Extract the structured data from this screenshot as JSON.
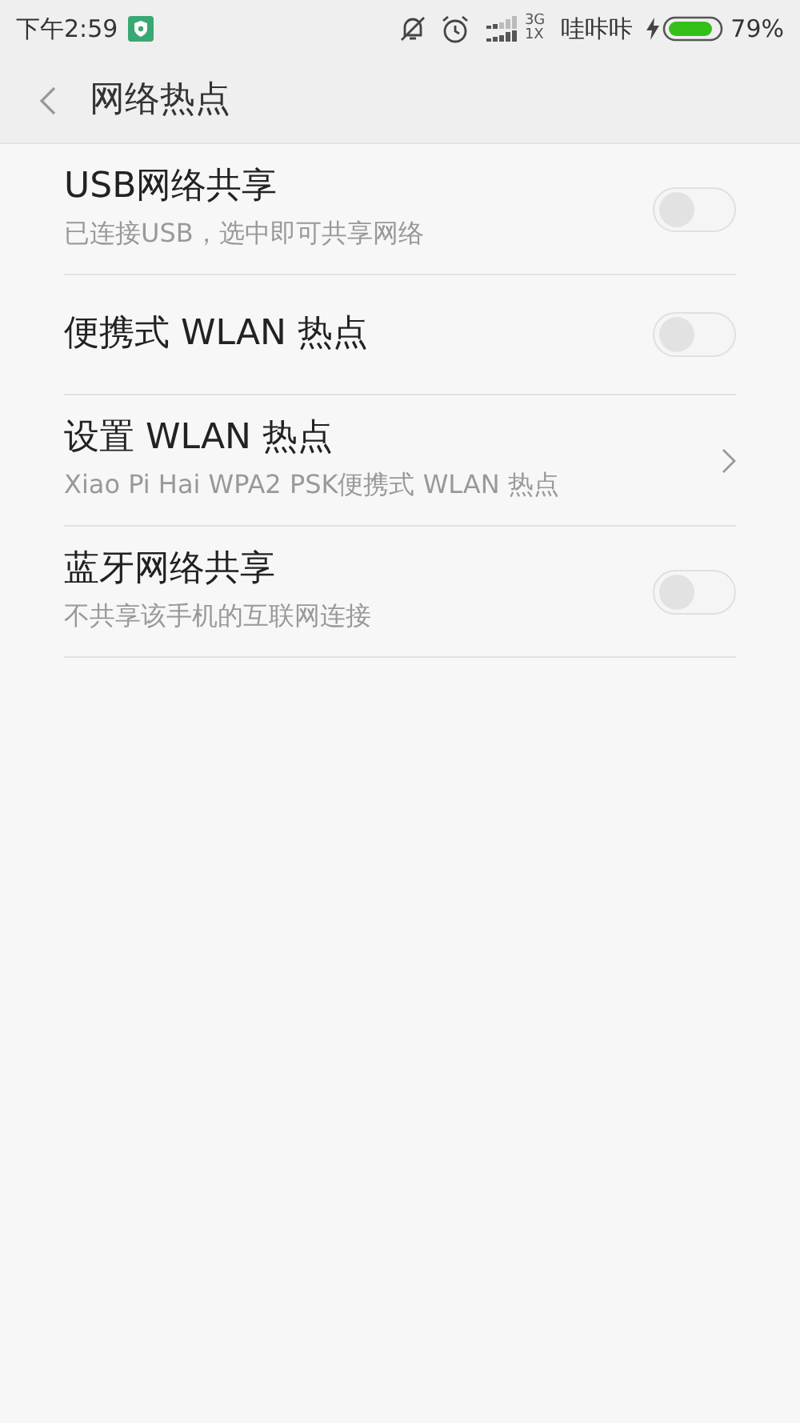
{
  "status_bar": {
    "time": "下午2:59",
    "network_top": "3G",
    "network_bottom": "1X",
    "carrier": "哇咔咔",
    "battery": "79%"
  },
  "header": {
    "title": "网络热点"
  },
  "items": [
    {
      "kind": "toggle",
      "title": "USB网络共享",
      "subtitle": "已连接USB，选中即可共享网络",
      "on": false
    },
    {
      "kind": "toggle",
      "title": "便携式 WLAN 热点",
      "on": false
    },
    {
      "kind": "link",
      "title": "设置 WLAN 热点",
      "subtitle": "Xiao Pi Hai WPA2 PSK便携式 WLAN 热点"
    },
    {
      "kind": "toggle",
      "title": "蓝牙网络共享",
      "subtitle": "不共享该手机的互联网连接",
      "on": false
    }
  ]
}
